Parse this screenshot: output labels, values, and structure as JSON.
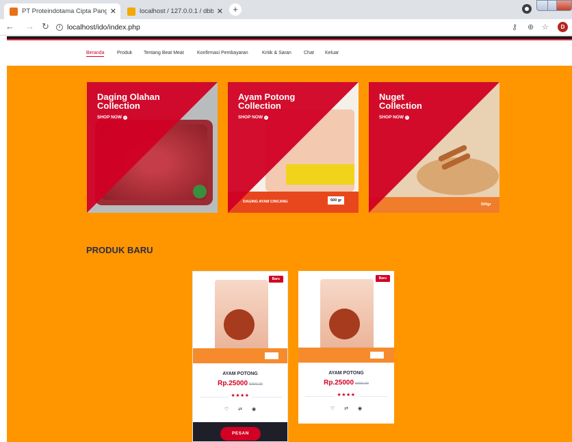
{
  "browser": {
    "tabs": [
      {
        "title": "PT Proteindotama Cipta Pangan",
        "active": true
      },
      {
        "title": "localhost / 127.0.0.1 / dbbestme",
        "active": false
      }
    ],
    "url": "localhost/ido/index.php",
    "profile_initial": "D"
  },
  "nav": {
    "items": [
      "Beranda",
      "Produk",
      "Tentang Beat Meat",
      "Konfirmasi Pembayaran",
      "Kritik & Saran",
      "Chat",
      "Keluar"
    ]
  },
  "collections": [
    {
      "title_line1": "Daging Olahan",
      "title_line2": "Collection",
      "cta": "SHOP NOW"
    },
    {
      "title_line1": "Ayam Potong",
      "title_line2": "Collection",
      "cta": "SHOP NOW",
      "label": "DAGING AYAM CINCANG",
      "weight": "500 gr"
    },
    {
      "title_line1": "Nuget",
      "title_line2": "Collection",
      "cta": "SHOP NOW",
      "weight": "500gr"
    }
  ],
  "section_title": "PRODUK BARU",
  "products": [
    {
      "badge": "Baru",
      "name": "AYAM POTONG",
      "price": "Rp.25000",
      "old_price": "5000.00",
      "stars": "★★★★",
      "order_label": "PESAN"
    },
    {
      "badge": "Baru",
      "name": "AYAM POTONG",
      "price": "Rp.25000",
      "old_price": "5000.00",
      "stars": "★★★★"
    }
  ],
  "colors": {
    "page_bg": "#ff9600",
    "accent": "#d10024",
    "dark": "#1e1f29"
  }
}
